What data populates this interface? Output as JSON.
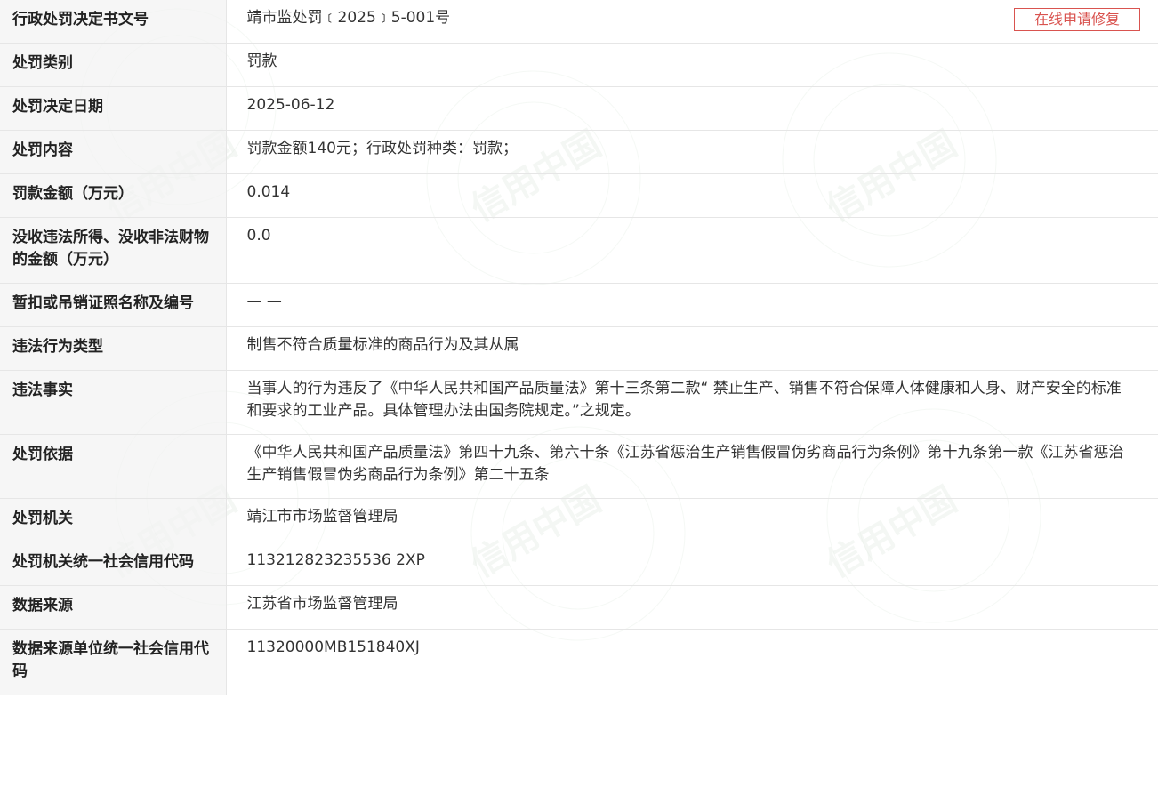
{
  "actions": {
    "repair_button_label": "在线申请修复"
  },
  "rows": [
    {
      "label": "行政处罚决定书文号",
      "value": "靖市监处罚﹝2025﹞5-001号"
    },
    {
      "label": "处罚类别",
      "value": "罚款"
    },
    {
      "label": "处罚决定日期",
      "value": "2025-06-12"
    },
    {
      "label": "处罚内容",
      "value": "罚款金额140元；行政处罚种类：罚款；"
    },
    {
      "label": "罚款金额（万元）",
      "value": "0.014"
    },
    {
      "label": "没收违法所得、没收非法财物的金额（万元）",
      "value": "0.0"
    },
    {
      "label": "暂扣或吊销证照名称及编号",
      "value": "— —"
    },
    {
      "label": "违法行为类型",
      "value": "制售不符合质量标准的商品行为及其从属"
    },
    {
      "label": "违法事实",
      "value": "当事人的行为违反了《中华人民共和国产品质量法》第十三条第二款“ 禁止生产、销售不符合保障人体健康和人身、财产安全的标准和要求的工业产品。具体管理办法由国务院规定。”之规定。"
    },
    {
      "label": "处罚依据",
      "value": "《中华人民共和国产品质量法》第四十九条、第六十条《江苏省惩治生产销售假冒伪劣商品行为条例》第十九条第一款《江苏省惩治生产销售假冒伪劣商品行为条例》第二十五条"
    },
    {
      "label": "处罚机关",
      "value": "靖江市市场监督管理局"
    },
    {
      "label": "处罚机关统一社会信用代码",
      "value": "113212823235536 2XP"
    },
    {
      "label": "数据来源",
      "value": "江苏省市场监督管理局"
    },
    {
      "label": "数据来源单位统一社会信用代码",
      "value": "11320000MB151840XJ"
    }
  ],
  "watermark": {
    "text": "信用中国",
    "color": "#c9d8c9"
  }
}
